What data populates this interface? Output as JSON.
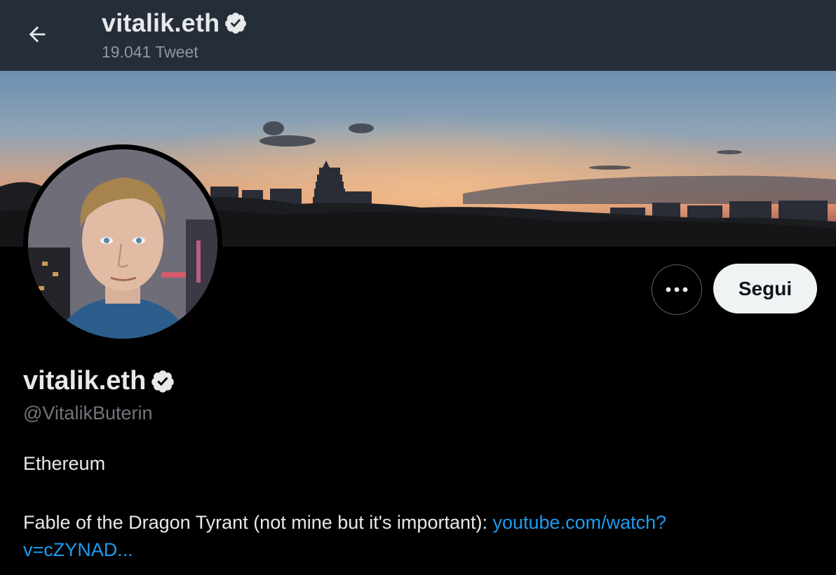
{
  "header": {
    "back_icon": "arrow-left-icon",
    "name": "vitalik.eth",
    "verified_icon": "verified-badge-icon",
    "tweet_count": "19.041 Tweet"
  },
  "profile": {
    "name": "vitalik.eth",
    "handle": "@VitalikButerin",
    "bio_line1": "Ethereum",
    "bio_text": "Fable of the Dragon Tyrant (not mine but it's important): ",
    "bio_link_line1": "youtube.com/watch?",
    "bio_link_line2": "v=cZYNAD..."
  },
  "actions": {
    "more_icon": "more-dots-icon",
    "follow_label": "Segui"
  },
  "colors": {
    "header_bg": "#252d39",
    "background": "#000000",
    "link": "#1d9bf0",
    "follow_bg": "#eff3f4",
    "secondary_text": "#71767b"
  }
}
